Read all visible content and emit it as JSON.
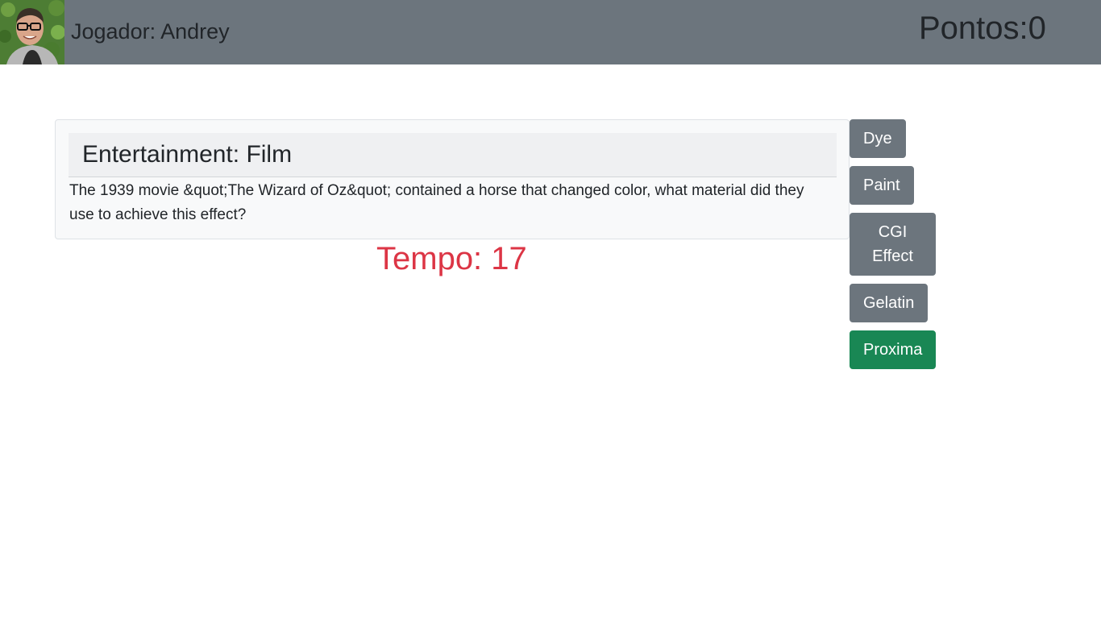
{
  "header": {
    "player_label": "Jogador: Andrey",
    "score_label": "Pontos:0"
  },
  "question": {
    "category": "Entertainment: Film",
    "text": "The 1939 movie &quot;The Wizard of Oz&quot; contained a horse that changed color, what material did they use to achieve this effect?"
  },
  "timer": {
    "label": "Tempo: 17"
  },
  "answers": [
    {
      "label": "Dye"
    },
    {
      "label": "Paint"
    },
    {
      "label": "CGI Effect"
    },
    {
      "label": "Gelatin"
    }
  ],
  "next_button": {
    "label": "Proxima"
  },
  "colors": {
    "header_bg": "#6c757d",
    "answer_button": "#6c757d",
    "next_button": "#198754",
    "timer_text": "#dc3545",
    "card_bg": "#f8f9fa"
  },
  "icons": {
    "avatar": "player-photo"
  }
}
